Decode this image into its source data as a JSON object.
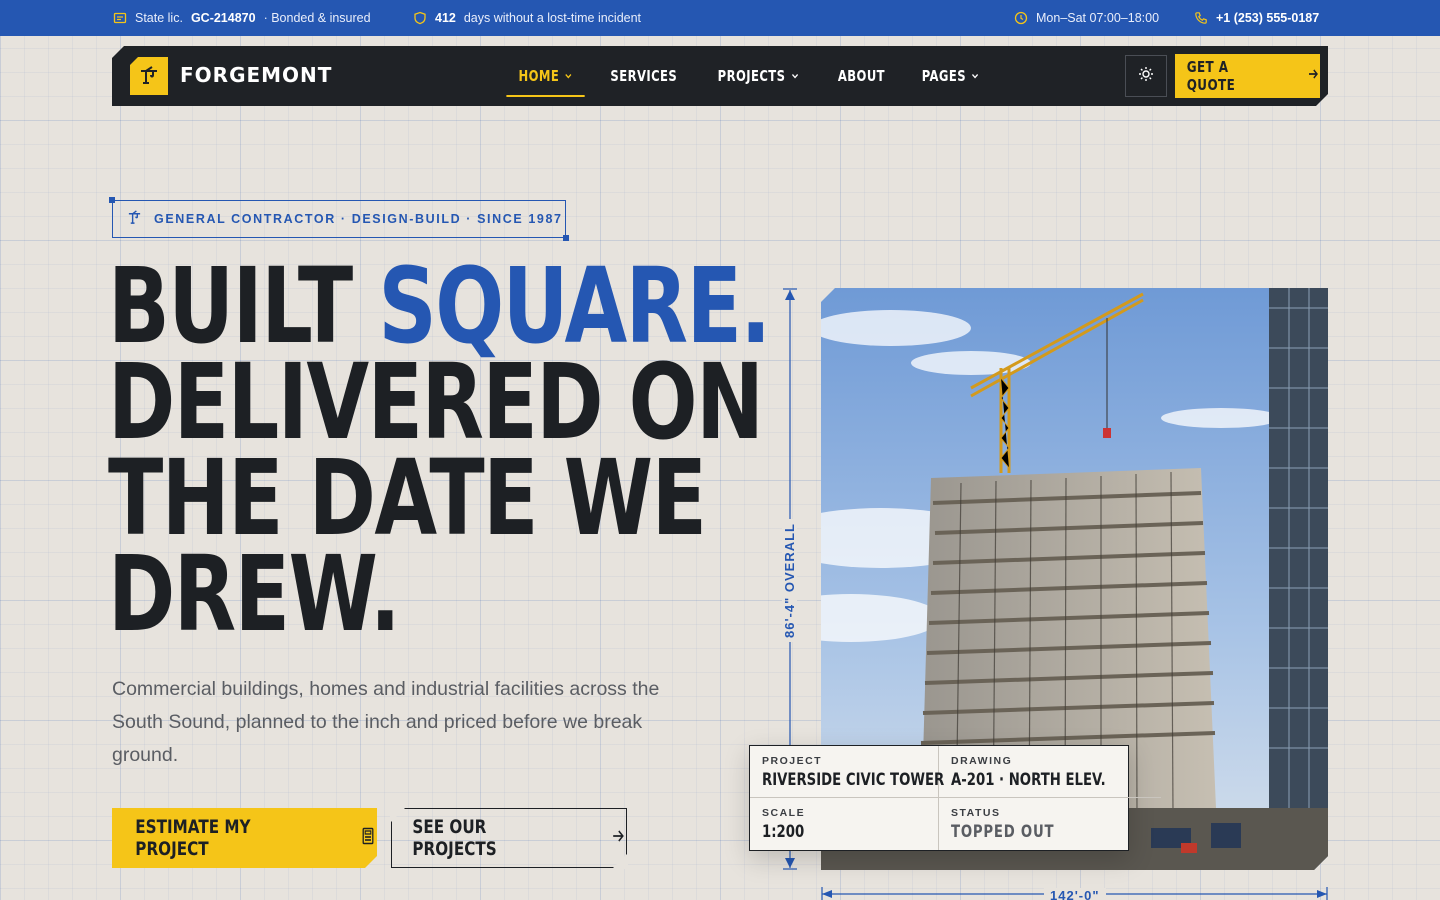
{
  "topbar": {
    "license_prefix": "State lic.",
    "license_no": "GC-214870",
    "license_suffix": "· Bonded & insured",
    "safety_days": "412",
    "safety_text": "days without a lost-time incident",
    "hours": "Mon–Sat 07:00–18:00",
    "phone": "+1 (253) 555-0187"
  },
  "brand": {
    "name": "FORGEMONT"
  },
  "nav": {
    "items": [
      {
        "label": "HOME",
        "active": true,
        "dropdown": true
      },
      {
        "label": "SERVICES",
        "active": false,
        "dropdown": false
      },
      {
        "label": "PROJECTS",
        "active": false,
        "dropdown": true
      },
      {
        "label": "ABOUT",
        "active": false,
        "dropdown": false
      },
      {
        "label": "PAGES",
        "active": false,
        "dropdown": true
      }
    ],
    "quote_label": "GET A QUOTE"
  },
  "hero": {
    "eyebrow": "GENERAL CONTRACTOR · DESIGN-BUILD · SINCE 1987",
    "headline_1a": "BUILT ",
    "headline_1b": "SQUARE.",
    "headline_2": "DELIVERED ON",
    "headline_3": "THE DATE WE",
    "headline_4": "DREW.",
    "lede": "Commercial buildings, homes and industrial facilities across the South Sound, planned to the inch and priced before we break ground.",
    "primary_cta": "ESTIMATE MY PROJECT",
    "secondary_cta": "SEE OUR PROJECTS"
  },
  "drawing": {
    "height_label": "86'-4\" OVERALL",
    "width_label": "142'-0\"",
    "title_block": {
      "project_key": "PROJECT",
      "project_val": "RIVERSIDE CIVIC TOWER",
      "drawing_key": "DRAWING",
      "drawing_val": "A-201 · NORTH ELEV.",
      "scale_key": "SCALE",
      "scale_val": "1:200",
      "status_key": "STATUS",
      "status_val": "TOPPED OUT"
    }
  },
  "colors": {
    "brand_blue": "#2557b2",
    "brand_yellow": "#f5c518",
    "nav_dark": "#1f2226",
    "background": "#e7e3dd"
  },
  "icons": {
    "license": "license-badge-icon",
    "safety": "shield-icon",
    "hours": "clock-icon",
    "phone": "phone-icon",
    "logo": "crane-hook-icon",
    "theme": "sun-icon",
    "quote_arrow": "arrow-right-icon",
    "estimate": "calculator-icon",
    "projects_arrow": "arrow-right-icon"
  }
}
